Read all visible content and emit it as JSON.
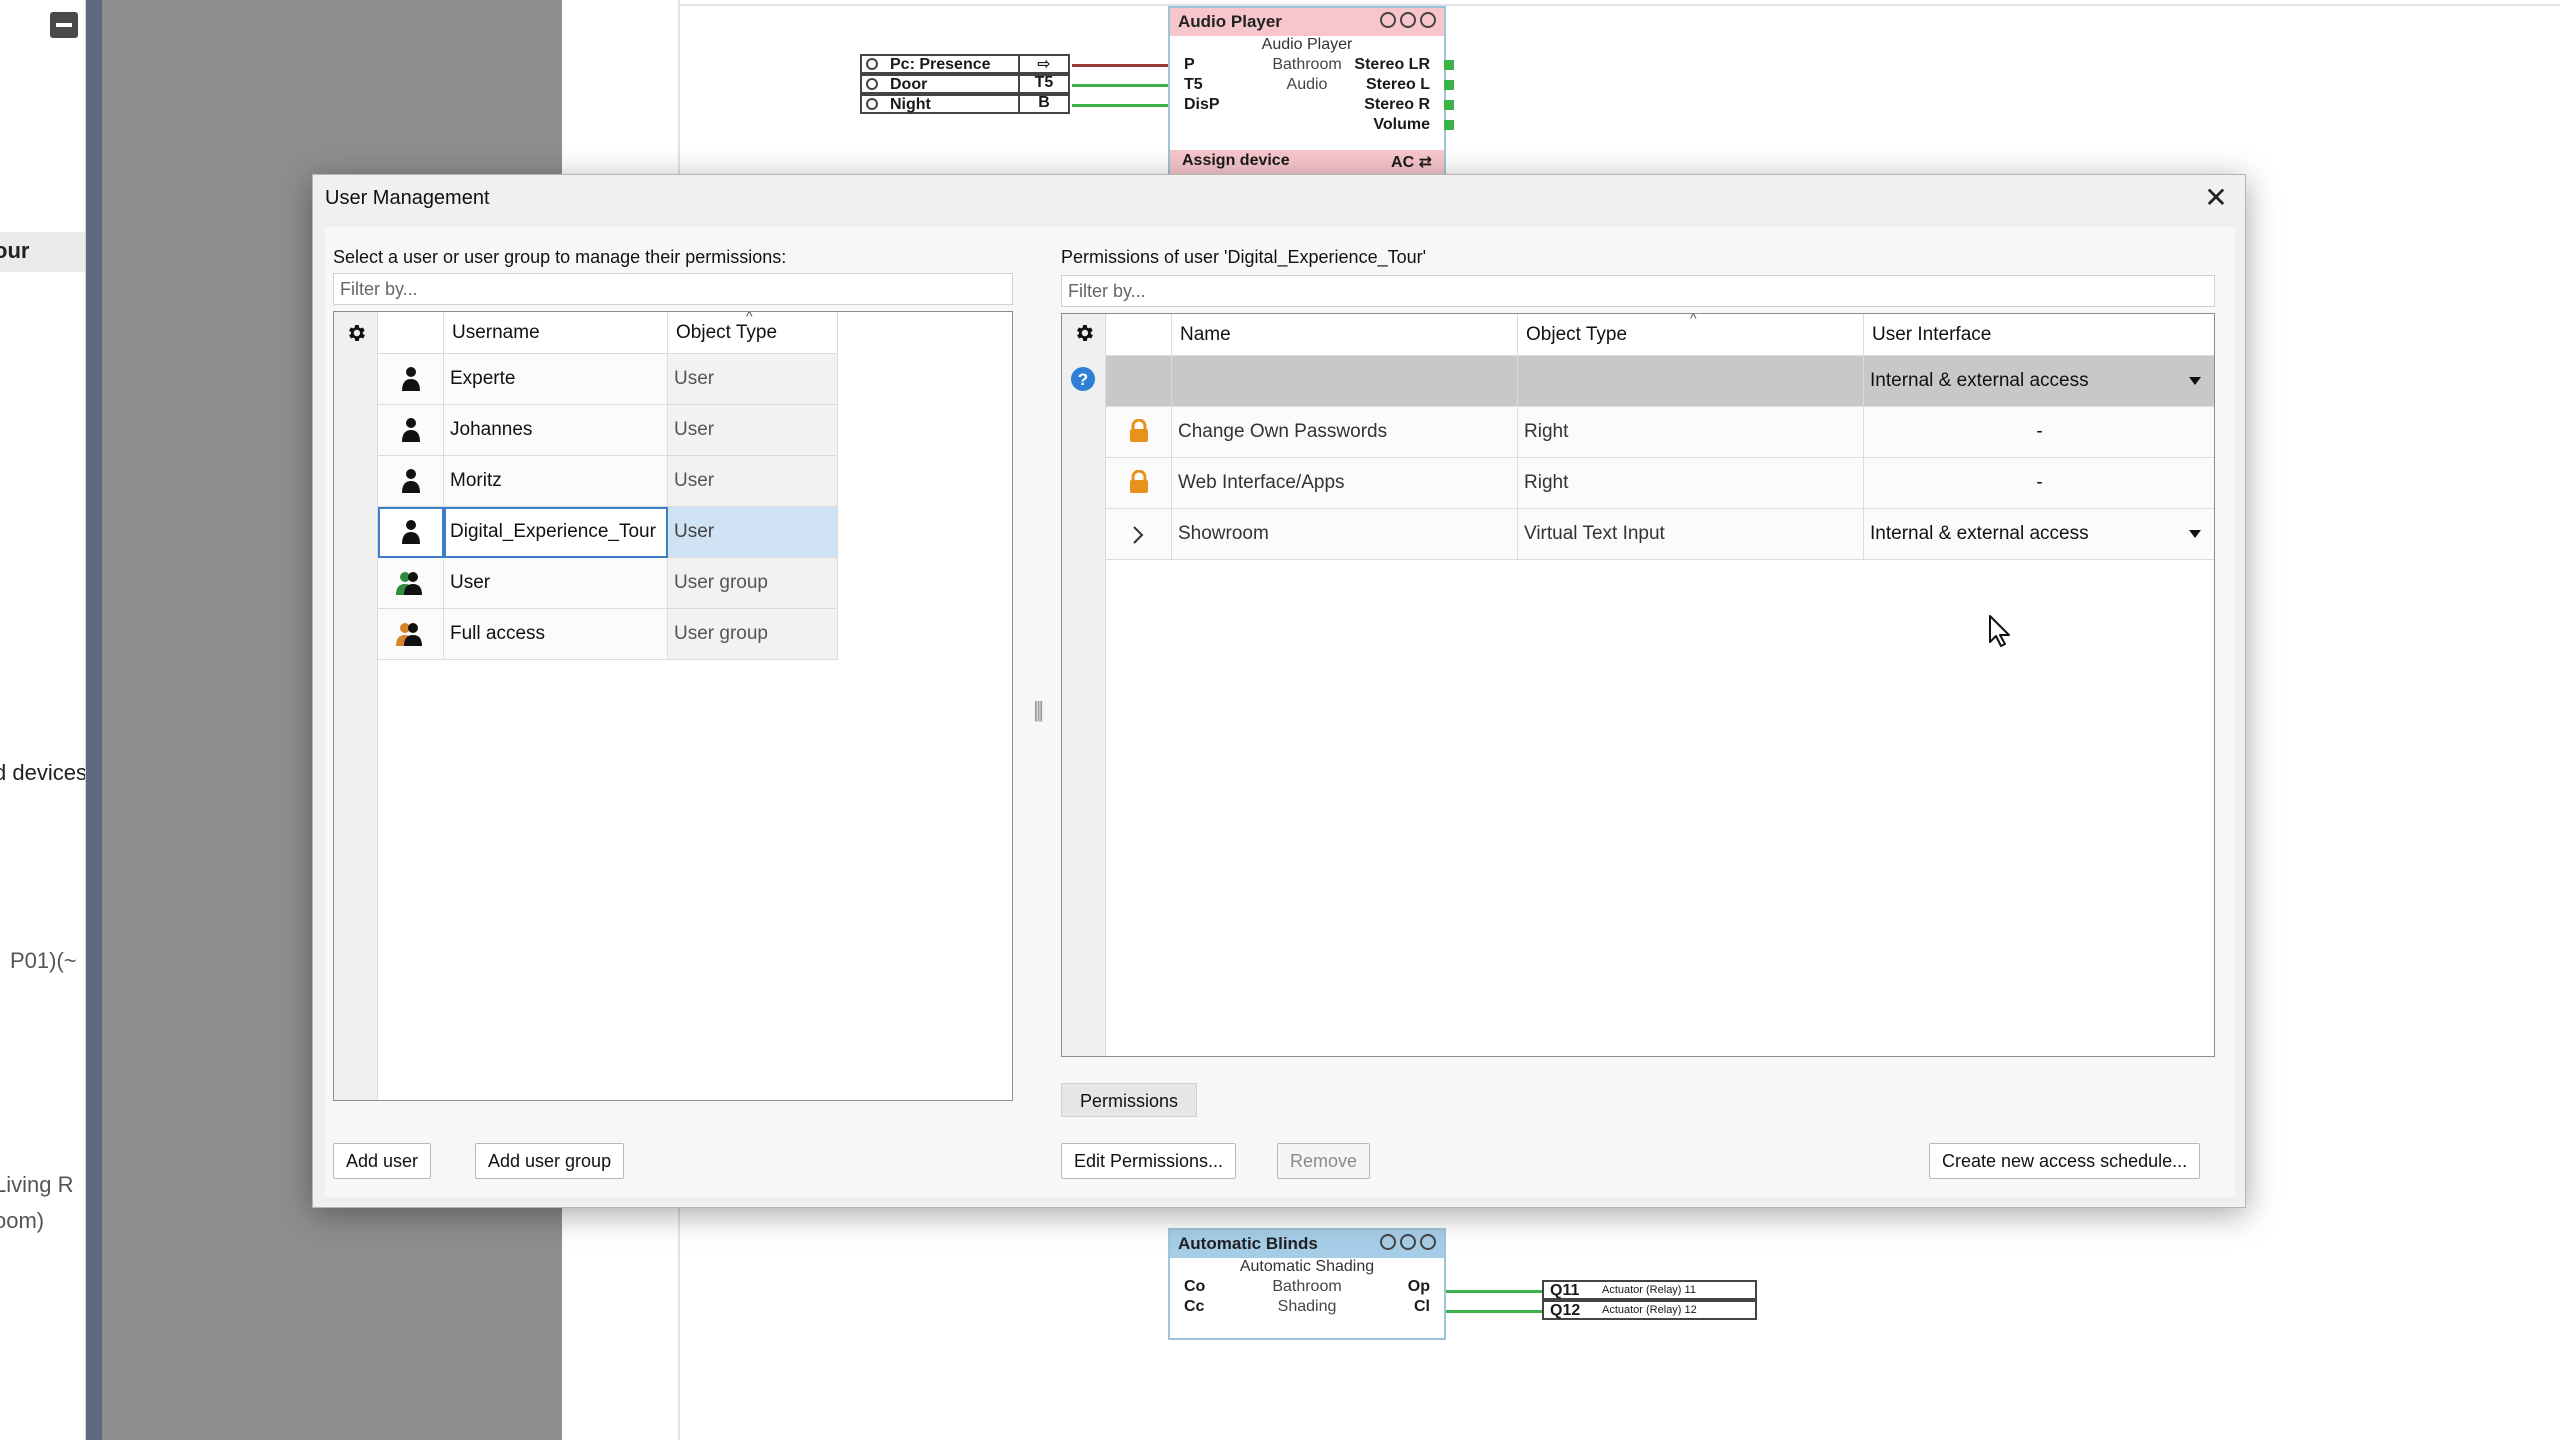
{
  "background": {
    "sidebar_fragments": [
      "our",
      "d devices",
      "P01)(~",
      "Living R",
      "oom)"
    ],
    "audio_player": {
      "title": "Audio Player",
      "subtitle": "Audio Player",
      "inputs": [
        {
          "name": "Pc: Presence",
          "key": "⇨"
        },
        {
          "name": "Door",
          "key": "T5"
        },
        {
          "name": "Night",
          "key": "B"
        }
      ],
      "rows": [
        {
          "left": "P",
          "center": "Bathroom",
          "right": "Stereo LR"
        },
        {
          "left": "T5",
          "center": "Audio",
          "right": "Stereo L"
        },
        {
          "left": "DisP",
          "center": "",
          "right": "Stereo R"
        },
        {
          "left": "",
          "center": "",
          "right": "Volume"
        }
      ],
      "footer_left": "Assign device",
      "footer_right": "AC ⇄"
    },
    "automatic_blinds": {
      "title": "Automatic Blinds",
      "subtitle": "Automatic Shading",
      "rows": [
        {
          "left": "Co",
          "center": "Bathroom",
          "right": "Op"
        },
        {
          "left": "Cc",
          "center": "Shading",
          "right": "Cl"
        }
      ],
      "outputs": [
        {
          "q": "Q11",
          "label": "Actuator (Relay) 11"
        },
        {
          "q": "Q12",
          "label": "Actuator (Relay) 12"
        }
      ]
    }
  },
  "dialog": {
    "title": "User Management",
    "close_label": "✕",
    "left": {
      "label": "Select a user or user group to manage their permissions:",
      "filter_placeholder": "Filter by...",
      "columns": [
        "Username",
        "Object Type"
      ],
      "rows": [
        {
          "username": "Experte",
          "type": "User",
          "icon": "person-icon"
        },
        {
          "username": "Johannes",
          "type": "User",
          "icon": "person-icon"
        },
        {
          "username": "Moritz",
          "type": "User",
          "icon": "person-icon"
        },
        {
          "username": "Digital_Experience_Tour",
          "type": "User",
          "icon": "person-icon",
          "selected": true
        },
        {
          "username": "User",
          "type": "User group",
          "icon": "user-group-icon"
        },
        {
          "username": "Full access",
          "type": "User group",
          "icon": "admin-group-icon"
        }
      ],
      "add_user": "Add user",
      "add_user_group": "Add user group"
    },
    "right": {
      "label": "Permissions of user 'Digital_Experience_Tour'",
      "filter_placeholder": "Filter by...",
      "columns": [
        "Name",
        "Object Type",
        "User Interface"
      ],
      "rows": [
        {
          "name": "",
          "type": "",
          "ui": "Internal & external access",
          "icon": "help-icon",
          "dropdown": true
        },
        {
          "name": "Change Own Passwords",
          "type": "Right",
          "ui": "-",
          "icon": "lock-icon"
        },
        {
          "name": "Web Interface/Apps",
          "type": "Right",
          "ui": "-",
          "icon": "lock-icon"
        },
        {
          "name": "Showroom",
          "type": "Virtual Text Input",
          "ui": "Internal & external access",
          "icon": "chevron-right-icon",
          "dropdown": true
        }
      ],
      "tab": "Permissions",
      "edit_permissions": "Edit Permissions...",
      "remove": "Remove",
      "create_schedule": "Create new access schedule..."
    }
  },
  "colors": {
    "selection": "#cfe3f5",
    "selection_border": "#3d7fc9",
    "lock": "#e8921c",
    "help": "#2e7fd6",
    "connector_green": "#3bb34a"
  }
}
